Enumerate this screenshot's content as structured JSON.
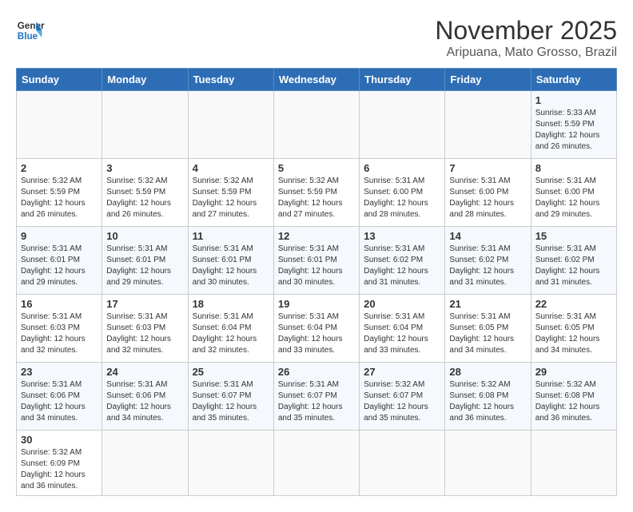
{
  "header": {
    "logo_line1": "General",
    "logo_line2": "Blue",
    "title": "November 2025",
    "subtitle": "Aripuana, Mato Grosso, Brazil"
  },
  "calendar": {
    "days_of_week": [
      "Sunday",
      "Monday",
      "Tuesday",
      "Wednesday",
      "Thursday",
      "Friday",
      "Saturday"
    ],
    "weeks": [
      [
        {
          "day": "",
          "info": ""
        },
        {
          "day": "",
          "info": ""
        },
        {
          "day": "",
          "info": ""
        },
        {
          "day": "",
          "info": ""
        },
        {
          "day": "",
          "info": ""
        },
        {
          "day": "",
          "info": ""
        },
        {
          "day": "1",
          "info": "Sunrise: 5:33 AM\nSunset: 5:59 PM\nDaylight: 12 hours\nand 26 minutes."
        }
      ],
      [
        {
          "day": "2",
          "info": "Sunrise: 5:32 AM\nSunset: 5:59 PM\nDaylight: 12 hours\nand 26 minutes."
        },
        {
          "day": "3",
          "info": "Sunrise: 5:32 AM\nSunset: 5:59 PM\nDaylight: 12 hours\nand 26 minutes."
        },
        {
          "day": "4",
          "info": "Sunrise: 5:32 AM\nSunset: 5:59 PM\nDaylight: 12 hours\nand 27 minutes."
        },
        {
          "day": "5",
          "info": "Sunrise: 5:32 AM\nSunset: 5:59 PM\nDaylight: 12 hours\nand 27 minutes."
        },
        {
          "day": "6",
          "info": "Sunrise: 5:31 AM\nSunset: 6:00 PM\nDaylight: 12 hours\nand 28 minutes."
        },
        {
          "day": "7",
          "info": "Sunrise: 5:31 AM\nSunset: 6:00 PM\nDaylight: 12 hours\nand 28 minutes."
        },
        {
          "day": "8",
          "info": "Sunrise: 5:31 AM\nSunset: 6:00 PM\nDaylight: 12 hours\nand 29 minutes."
        }
      ],
      [
        {
          "day": "9",
          "info": "Sunrise: 5:31 AM\nSunset: 6:01 PM\nDaylight: 12 hours\nand 29 minutes."
        },
        {
          "day": "10",
          "info": "Sunrise: 5:31 AM\nSunset: 6:01 PM\nDaylight: 12 hours\nand 29 minutes."
        },
        {
          "day": "11",
          "info": "Sunrise: 5:31 AM\nSunset: 6:01 PM\nDaylight: 12 hours\nand 30 minutes."
        },
        {
          "day": "12",
          "info": "Sunrise: 5:31 AM\nSunset: 6:01 PM\nDaylight: 12 hours\nand 30 minutes."
        },
        {
          "day": "13",
          "info": "Sunrise: 5:31 AM\nSunset: 6:02 PM\nDaylight: 12 hours\nand 31 minutes."
        },
        {
          "day": "14",
          "info": "Sunrise: 5:31 AM\nSunset: 6:02 PM\nDaylight: 12 hours\nand 31 minutes."
        },
        {
          "day": "15",
          "info": "Sunrise: 5:31 AM\nSunset: 6:02 PM\nDaylight: 12 hours\nand 31 minutes."
        }
      ],
      [
        {
          "day": "16",
          "info": "Sunrise: 5:31 AM\nSunset: 6:03 PM\nDaylight: 12 hours\nand 32 minutes."
        },
        {
          "day": "17",
          "info": "Sunrise: 5:31 AM\nSunset: 6:03 PM\nDaylight: 12 hours\nand 32 minutes."
        },
        {
          "day": "18",
          "info": "Sunrise: 5:31 AM\nSunset: 6:04 PM\nDaylight: 12 hours\nand 32 minutes."
        },
        {
          "day": "19",
          "info": "Sunrise: 5:31 AM\nSunset: 6:04 PM\nDaylight: 12 hours\nand 33 minutes."
        },
        {
          "day": "20",
          "info": "Sunrise: 5:31 AM\nSunset: 6:04 PM\nDaylight: 12 hours\nand 33 minutes."
        },
        {
          "day": "21",
          "info": "Sunrise: 5:31 AM\nSunset: 6:05 PM\nDaylight: 12 hours\nand 34 minutes."
        },
        {
          "day": "22",
          "info": "Sunrise: 5:31 AM\nSunset: 6:05 PM\nDaylight: 12 hours\nand 34 minutes."
        }
      ],
      [
        {
          "day": "23",
          "info": "Sunrise: 5:31 AM\nSunset: 6:06 PM\nDaylight: 12 hours\nand 34 minutes."
        },
        {
          "day": "24",
          "info": "Sunrise: 5:31 AM\nSunset: 6:06 PM\nDaylight: 12 hours\nand 34 minutes."
        },
        {
          "day": "25",
          "info": "Sunrise: 5:31 AM\nSunset: 6:07 PM\nDaylight: 12 hours\nand 35 minutes."
        },
        {
          "day": "26",
          "info": "Sunrise: 5:31 AM\nSunset: 6:07 PM\nDaylight: 12 hours\nand 35 minutes."
        },
        {
          "day": "27",
          "info": "Sunrise: 5:32 AM\nSunset: 6:07 PM\nDaylight: 12 hours\nand 35 minutes."
        },
        {
          "day": "28",
          "info": "Sunrise: 5:32 AM\nSunset: 6:08 PM\nDaylight: 12 hours\nand 36 minutes."
        },
        {
          "day": "29",
          "info": "Sunrise: 5:32 AM\nSunset: 6:08 PM\nDaylight: 12 hours\nand 36 minutes."
        }
      ],
      [
        {
          "day": "30",
          "info": "Sunrise: 5:32 AM\nSunset: 6:09 PM\nDaylight: 12 hours\nand 36 minutes."
        },
        {
          "day": "",
          "info": ""
        },
        {
          "day": "",
          "info": ""
        },
        {
          "day": "",
          "info": ""
        },
        {
          "day": "",
          "info": ""
        },
        {
          "day": "",
          "info": ""
        },
        {
          "day": "",
          "info": ""
        }
      ]
    ]
  }
}
